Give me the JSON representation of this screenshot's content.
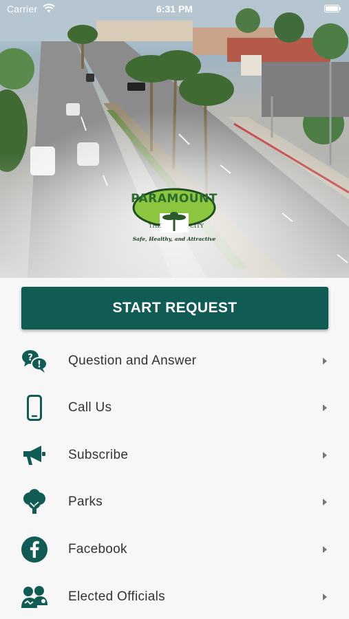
{
  "status_bar": {
    "carrier": "Carrier",
    "time": "6:31 PM",
    "wifi_icon": "wifi-icon",
    "battery_icon": "battery-icon"
  },
  "hero": {
    "logo": {
      "title": "PARAMOUNT",
      "the": "THE",
      "city": "CITY",
      "tagline": "Safe, Healthy, and Attractive"
    }
  },
  "start_button": {
    "label": "START REQUEST",
    "color": "#105c55"
  },
  "theme": {
    "accent": "#105c55",
    "text": "#333333",
    "background": "#f7f7f7"
  },
  "menu": {
    "items": [
      {
        "label": "Question and Answer",
        "icon": "question-answer-icon"
      },
      {
        "label": "Call Us",
        "icon": "phone-icon"
      },
      {
        "label": "Subscribe",
        "icon": "megaphone-icon"
      },
      {
        "label": "Parks",
        "icon": "tree-icon"
      },
      {
        "label": "Facebook",
        "icon": "facebook-icon"
      },
      {
        "label": "Elected Officials",
        "icon": "officials-icon"
      }
    ]
  }
}
